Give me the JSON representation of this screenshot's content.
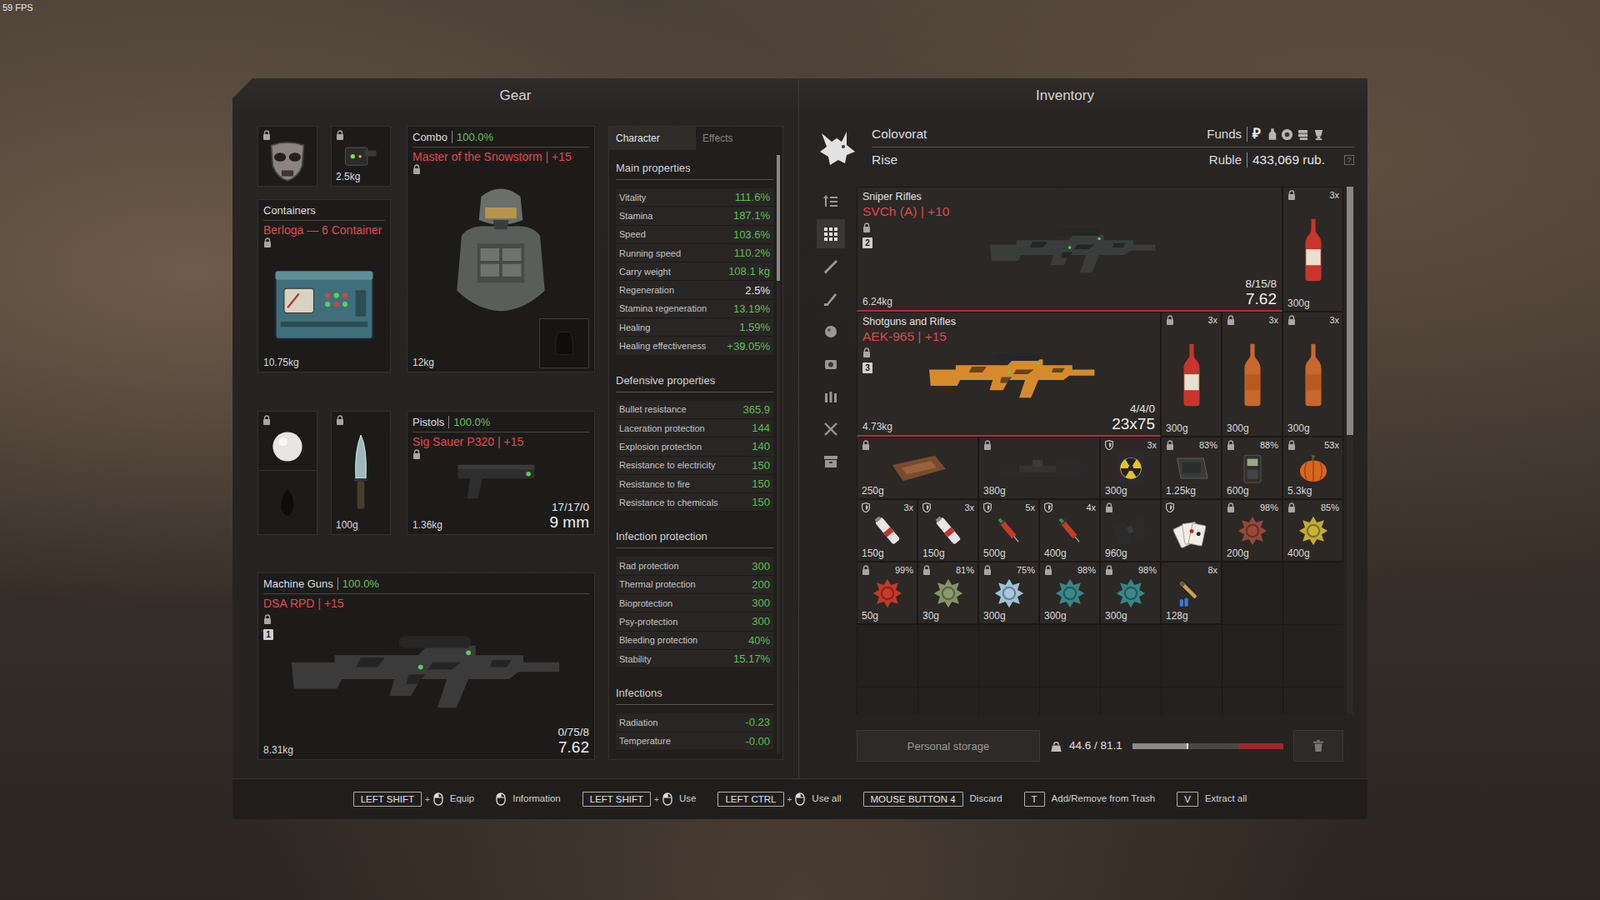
{
  "fps": "59 FPS",
  "gear": {
    "title": "Gear",
    "head": {
      "locked": true
    },
    "detector": {
      "locked": true,
      "weight": "2.5kg"
    },
    "container": {
      "label": "Containers",
      "name": "Berloga — 6 Container",
      "weight": "10.75kg",
      "locked": true
    },
    "armor": {
      "category": "Combo",
      "condition": "100.0%",
      "name": "Master of the Snowstorm | +15",
      "weight": "12kg",
      "locked": true
    },
    "artifact": {
      "locked": true
    },
    "knife": {
      "locked": true,
      "weight": "100g"
    },
    "pistol": {
      "category": "Pistols",
      "condition": "100.0%",
      "name": "Sig Sauer P320 | +15",
      "ammo": "17/17/0",
      "caliber": "9 mm",
      "weight": "1.36kg",
      "locked": true
    },
    "machine_gun": {
      "category": "Machine Guns",
      "condition": "100.0%",
      "name": "DSA RPD | +15",
      "slot": "1",
      "ammo": "0/75/8",
      "caliber": "7.62",
      "weight": "8.31kg",
      "locked": true
    }
  },
  "stats": {
    "tabs": [
      {
        "label": "Character",
        "selected": true
      },
      {
        "label": "Effects",
        "selected": false
      }
    ],
    "sections": [
      {
        "title": "Main properties",
        "rows": [
          {
            "label": "Vitality",
            "value": "111.6%",
            "color": "#5fbf4e"
          },
          {
            "label": "Stamina",
            "value": "187.1%",
            "color": "#5fbf4e"
          },
          {
            "label": "Speed",
            "value": "103.6%",
            "color": "#5fbf4e"
          },
          {
            "label": "Running speed",
            "value": "110.2%",
            "color": "#5fbf4e"
          },
          {
            "label": "Carry weight",
            "value": "108.1 kg",
            "color": "#5fbf4e"
          },
          {
            "label": "Regeneration",
            "value": "2.5%",
            "color": "#e6e6e6"
          },
          {
            "label": "Stamina regeneration",
            "value": "13.19%",
            "color": "#5fbf4e"
          },
          {
            "label": "Healing",
            "value": "1.59%",
            "color": "#5fbf4e"
          },
          {
            "label": "Healing effectiveness",
            "value": "+39.05%",
            "color": "#5fbf4e"
          }
        ]
      },
      {
        "title": "Defensive properties",
        "rows": [
          {
            "label": "Bullet resistance",
            "value": "365.9",
            "color": "#5fbf4e"
          },
          {
            "label": "Laceration protection",
            "value": "144",
            "color": "#5fbf4e"
          },
          {
            "label": "Explosion protection",
            "value": "140",
            "color": "#5fbf4e"
          },
          {
            "label": "Resistance to electricity",
            "value": "150",
            "color": "#5fbf4e"
          },
          {
            "label": "Resistance to fire",
            "value": "150",
            "color": "#5fbf4e"
          },
          {
            "label": "Resistance to chemicals",
            "value": "150",
            "color": "#5fbf4e"
          }
        ]
      },
      {
        "title": "Infection protection",
        "rows": [
          {
            "label": "Rad protection",
            "value": "300",
            "color": "#5fbf4e"
          },
          {
            "label": "Thermal protection",
            "value": "200",
            "color": "#5fbf4e"
          },
          {
            "label": "Bioprotection",
            "value": "300",
            "color": "#5fbf4e"
          },
          {
            "label": "Psy-protection",
            "value": "300",
            "color": "#5fbf4e"
          },
          {
            "label": "Bleeding protection",
            "value": "40%",
            "color": "#5fbf4e"
          },
          {
            "label": "Stability",
            "value": "15.17%",
            "color": "#5fbf4e"
          }
        ]
      },
      {
        "title": "Infections",
        "rows": [
          {
            "label": "Radiation",
            "value": "-0.23",
            "color": "#5fbf4e"
          },
          {
            "label": "Temperature",
            "value": "-0.00",
            "color": "#5fbf4e"
          }
        ]
      }
    ],
    "scrollbar": {
      "level": 0.21
    }
  },
  "inventory": {
    "title": "Inventory",
    "player": {
      "name": "Colovorat",
      "rank": "Rise"
    },
    "funds": {
      "label": "Funds",
      "symbol": "₽",
      "currency": "Ruble",
      "amount": "433,069 rub.",
      "help": "?"
    },
    "side_tabs": [
      {
        "kind": "sort",
        "selected": false
      },
      {
        "kind": "all",
        "selected": true
      },
      {
        "kind": "rifles",
        "selected": false
      },
      {
        "kind": "melee",
        "selected": false
      },
      {
        "kind": "artifacts",
        "selected": false
      },
      {
        "kind": "devices",
        "selected": false
      },
      {
        "kind": "ammo",
        "selected": false
      },
      {
        "kind": "tools",
        "selected": false
      },
      {
        "kind": "storage",
        "selected": false
      }
    ],
    "items": [
      {
        "kind": "weapon",
        "category": "Sniper Rifles",
        "name": "SVCh (A) | +10",
        "mark": "locked",
        "slot": "2",
        "weight": "6.24kg",
        "ammo": "8/15/8",
        "caliber": "7.62",
        "color": "#3b3d3c"
      },
      {
        "kind": "vodka",
        "corner": "3x",
        "weight": "300g",
        "mark": "locked",
        "color": "#c8352c"
      },
      {
        "kind": "weapon",
        "category": "Shotguns and Rifles",
        "name": "AEK-965 | +15",
        "mark": "locked",
        "slot": "3",
        "weight": "4.73kg",
        "ammo": "4/4/0",
        "caliber": "23x75",
        "color": "#d68a2c"
      },
      {
        "kind": "vodka",
        "corner": "3x",
        "weight": "300g",
        "mark": "locked",
        "color": "#c8352c"
      },
      {
        "kind": "drink",
        "corner": "3x",
        "weight": "300g",
        "mark": "locked",
        "color": "#c8682c"
      },
      {
        "kind": "drink",
        "corner": "3x",
        "weight": "300g",
        "mark": "locked",
        "color": "#c8682c"
      },
      {
        "kind": "kit",
        "weight": "250g",
        "mark": "locked"
      },
      {
        "kind": "scope",
        "weight": "380g",
        "mark": "locked"
      },
      {
        "kind": "disc",
        "corner": "3x",
        "weight": "300g",
        "mark": "shielded"
      },
      {
        "kind": "device",
        "corner": "83%",
        "weight": "1.25kg",
        "mark": "locked"
      },
      {
        "kind": "radio",
        "corner": "88%",
        "weight": "600g",
        "mark": "locked"
      },
      {
        "kind": "pumpkin",
        "corner": "53x",
        "weight": "5.3kg",
        "mark": "locked"
      },
      {
        "kind": "canister",
        "corner": "3x",
        "weight": "150g",
        "mark": "shielded"
      },
      {
        "kind": "canister",
        "corner": "3x",
        "weight": "150g",
        "mark": "shielded"
      },
      {
        "kind": "syringe",
        "corner": "5x",
        "weight": "500g",
        "mark": "shielded"
      },
      {
        "kind": "syringe",
        "corner": "4x",
        "weight": "400g",
        "mark": "shielded"
      },
      {
        "kind": "binoculars",
        "weight": "960g",
        "mark": "locked"
      },
      {
        "kind": "cards",
        "mark": "shielded"
      },
      {
        "kind": "artifact",
        "corner": "98%",
        "weight": "200g",
        "mark": "locked",
        "color": "#9a4a3a"
      },
      {
        "kind": "artifact",
        "corner": "85%",
        "weight": "400g",
        "mark": "locked",
        "color": "#c9b236"
      },
      {
        "kind": "artifact",
        "corner": "99%",
        "weight": "50g",
        "mark": "locked",
        "color": "#c83a2a"
      },
      {
        "kind": "artifact",
        "corner": "81%",
        "weight": "30g",
        "mark": "locked",
        "color": "#8a9a6a"
      },
      {
        "kind": "artifact",
        "corner": "75%",
        "weight": "300g",
        "mark": "locked",
        "color": "#a9c8de"
      },
      {
        "kind": "artifact",
        "corner": "98%",
        "weight": "300g",
        "mark": "locked",
        "color": "#3a8a8a"
      },
      {
        "kind": "artifact",
        "corner": "98%",
        "weight": "300g",
        "mark": "locked",
        "color": "#3a8a8a"
      },
      {
        "kind": "ammo",
        "corner": "8x",
        "weight": "128g",
        "mark": "none"
      }
    ],
    "scrollbar": {
      "level": 0.47
    },
    "storage": {
      "label": "Personal storage",
      "weight": "44.6 / 81.1",
      "level": 0.37
    }
  },
  "hints": [
    {
      "key": "LEFT SHIFT",
      "plus": "+",
      "mouse": true,
      "action": "Equip"
    },
    {
      "mouse": true,
      "action": "Information"
    },
    {
      "key": "LEFT SHIFT",
      "plus": "+",
      "mouse": true,
      "action": "Use"
    },
    {
      "key": "LEFT CTRL",
      "plus": "+",
      "mouse": true,
      "action": "Use all"
    },
    {
      "key": "MOUSE BUTTON 4",
      "mouse": false,
      "action": "Discard"
    },
    {
      "key": "T",
      "mouse": false,
      "action": "Add/Remove from Trash"
    },
    {
      "key": "V",
      "mouse": false,
      "action": "Extract all"
    }
  ]
}
